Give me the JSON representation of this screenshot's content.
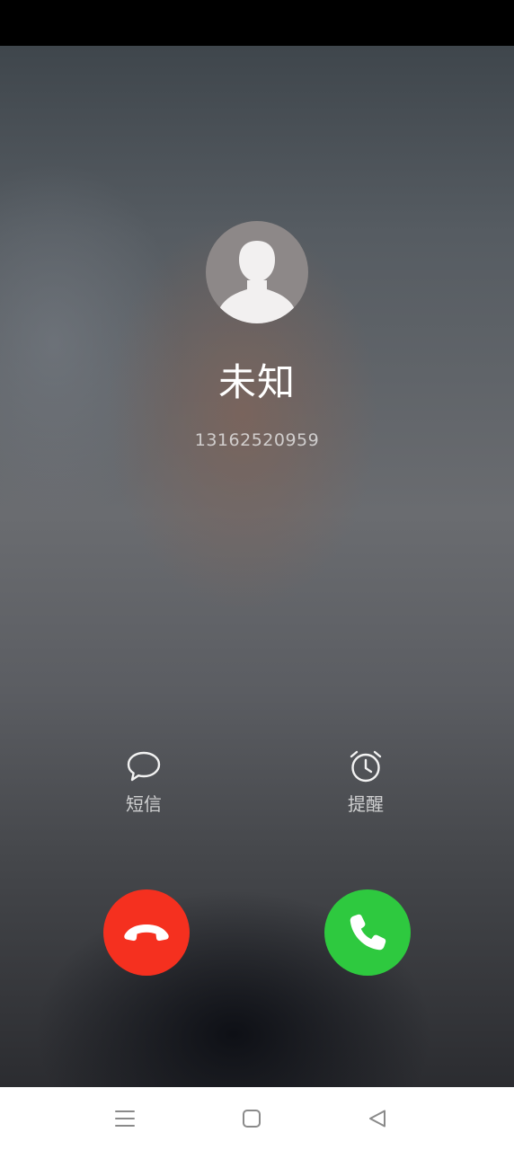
{
  "caller": {
    "name": "未知",
    "number": "13162520959",
    "avatar_icon": "default-avatar-icon"
  },
  "actions": {
    "message": {
      "label": "短信",
      "icon": "chat-bubble-icon"
    },
    "reminder": {
      "label": "提醒",
      "icon": "alarm-clock-icon"
    }
  },
  "call_buttons": {
    "decline": {
      "icon": "phone-hangup-icon",
      "color": "#f5301f"
    },
    "answer": {
      "icon": "phone-icon",
      "color": "#2ec93f"
    }
  },
  "nav_bar": {
    "menu_icon": "menu-icon",
    "home_icon": "home-square-icon",
    "back_icon": "back-triangle-icon"
  }
}
